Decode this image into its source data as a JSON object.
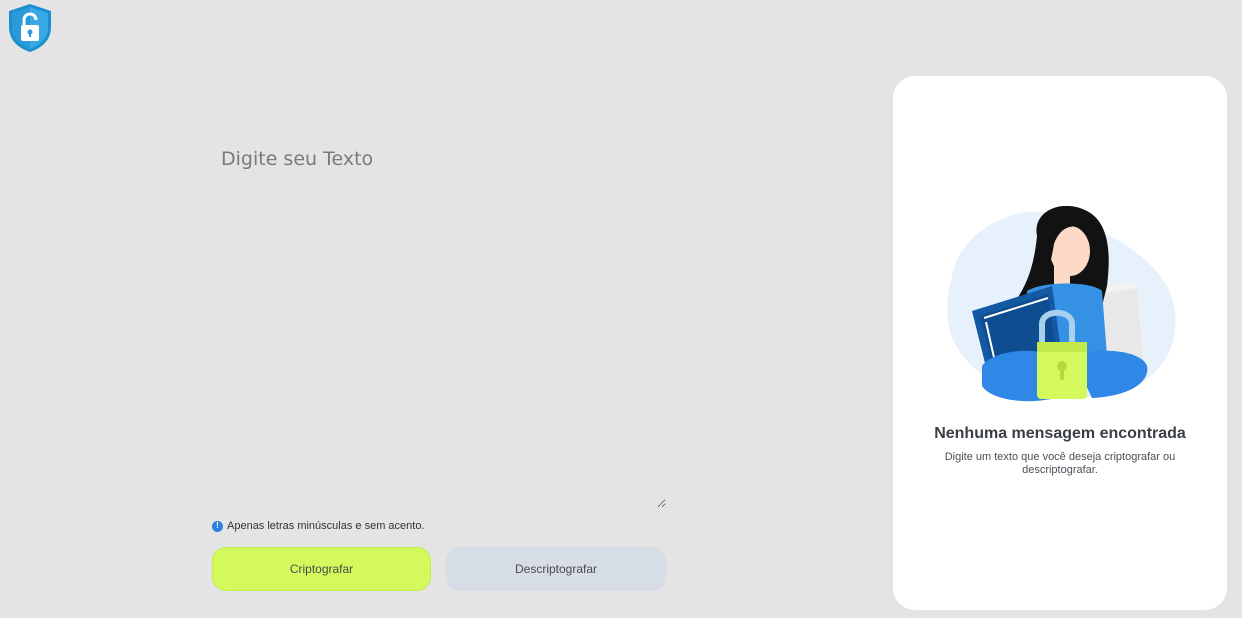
{
  "header": {
    "logo_icon": "shield-lock-icon"
  },
  "input": {
    "placeholder": "Digite seu Texto",
    "value": ""
  },
  "hint": {
    "icon": "info-icon",
    "glyph": "!",
    "text": "Apenas letras minúsculas e sem acento."
  },
  "buttons": {
    "encrypt_label": "Criptografar",
    "decrypt_label": "Descriptografar"
  },
  "output_panel": {
    "illustration": "woman-with-padlock-illustration",
    "title": "Nenhuma mensagem encontrada",
    "description": "Digite um texto que você deseja criptografar ou descriptografar."
  },
  "colors": {
    "background": "#e4e4e4",
    "encrypt_button": "#d4f95c",
    "decrypt_button": "#d6dde6",
    "panel": "#ffffff",
    "accent_blue": "#2f7fe0"
  }
}
